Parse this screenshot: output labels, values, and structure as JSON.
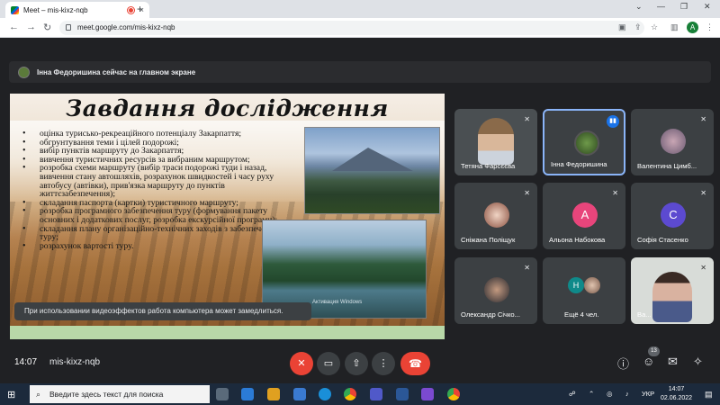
{
  "browser": {
    "tab_title": "Meet – mis-kixz-nqb",
    "tab_close": "×",
    "new_tab": "+",
    "url": "meet.google.com/mis-kixz-nqb",
    "profile_initial": "A",
    "window_controls": [
      "⌄",
      "—",
      "❐",
      "✕"
    ]
  },
  "meet": {
    "presenter_banner": "Інна Федоришина сейчас на главном экране",
    "slide": {
      "title": "Завдання дослідження",
      "bullets": [
        "оцінка турисько-рекреаційного потенціалу Закарпаття;",
        "обгрунтування теми і цілей подорожі;",
        "вибір пунктів маршруту до Закарпаття;",
        "вивчення туристичних ресурсів за вибраним маршрутом;",
        "розробка схеми маршруту (вибір траси подорожі туди і назад, вивчення стану автошляхів, розрахунок швидкостей і часу руху автобусу (автівки), прив'язка маршруту до пунктів життєзабезпечення);",
        "складання паспорта (картки) туристичного маршруту;",
        "розробка програмного забезпечення туру (формування пакету основних і додаткових послуг, розробка екскурсійної програми);",
        "складання плану організаційно-технічних заходів з забезпечення туру;",
        "розрахунок вартості туру."
      ],
      "watermark": "Активация Windows"
    },
    "toast": "При использовании видеоэффектов работа компьютера может замедлиться.",
    "participants": [
      {
        "name": "Тетяна Фарсєєва",
        "muted": true,
        "type": "video"
      },
      {
        "name": "Інна Федоришина",
        "muted": false,
        "type": "photo",
        "speaking": true
      },
      {
        "name": "Валентина Цимб...",
        "muted": true,
        "type": "photo"
      },
      {
        "name": "Сніжана Поліщук",
        "muted": true,
        "type": "photo"
      },
      {
        "name": "Альона Набокова",
        "muted": true,
        "type": "initial",
        "initial": "А",
        "color": "#e8457b"
      },
      {
        "name": "Софія Стасенко",
        "muted": true,
        "type": "initial",
        "initial": "С",
        "color": "#5c4ad0"
      },
      {
        "name": "Олександр Січко...",
        "muted": true,
        "type": "photo"
      },
      {
        "name": "Ещё 4 чел.",
        "muted": false,
        "type": "group",
        "initial": "Н"
      },
      {
        "name": "Ва...",
        "muted": true,
        "type": "video"
      }
    ],
    "controls": {
      "time": "14:07",
      "meeting_code": "mis-kixz-nqb",
      "participant_count": "13"
    }
  },
  "taskbar": {
    "search_placeholder": "Введите здесь текст для поиска",
    "language": "УКР",
    "time": "14:07",
    "date": "02.06.2022"
  }
}
